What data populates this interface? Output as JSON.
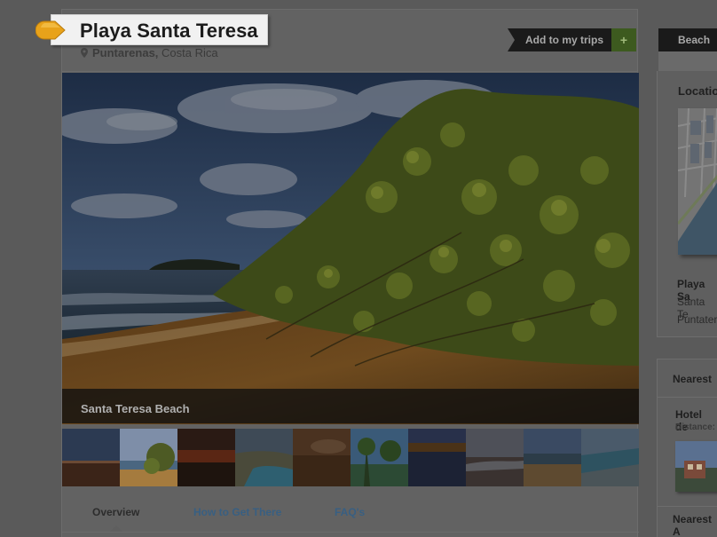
{
  "header": {
    "title": "Playa Santa Teresa",
    "region": "Puntarenas,",
    "country": "Costa Rica",
    "add_to_trips_label": "Add to my trips",
    "add_icon_glyph": "+"
  },
  "hero": {
    "caption": "Santa Teresa Beach",
    "thumbnail_count": 10,
    "selected_thumbnail": 2
  },
  "tabs": [
    {
      "label": "Overview",
      "active": true
    },
    {
      "label": "How to Get There",
      "active": false
    },
    {
      "label": "FAQ's",
      "active": false
    }
  ],
  "sidebar": {
    "category_tag": "Beach",
    "location_heading": "Locatio",
    "place_name": "Playa Sa",
    "place_line2": "Santa Te",
    "place_line3": "Puntater",
    "nearest_heading": "Nearest",
    "hotel_name": "Hotel de",
    "distance_label": "Distance:",
    "nearest_heading2": "Nearest A"
  },
  "colors": {
    "overlay": "#5a5a5a",
    "accent_green": "#3d5a1f",
    "link_blue": "#385f82",
    "marker_orange": "#e8a21a"
  },
  "icons": {
    "title_marker": "orange-pin-marker-icon",
    "location": "map-pin-icon",
    "add": "plus-icon"
  }
}
